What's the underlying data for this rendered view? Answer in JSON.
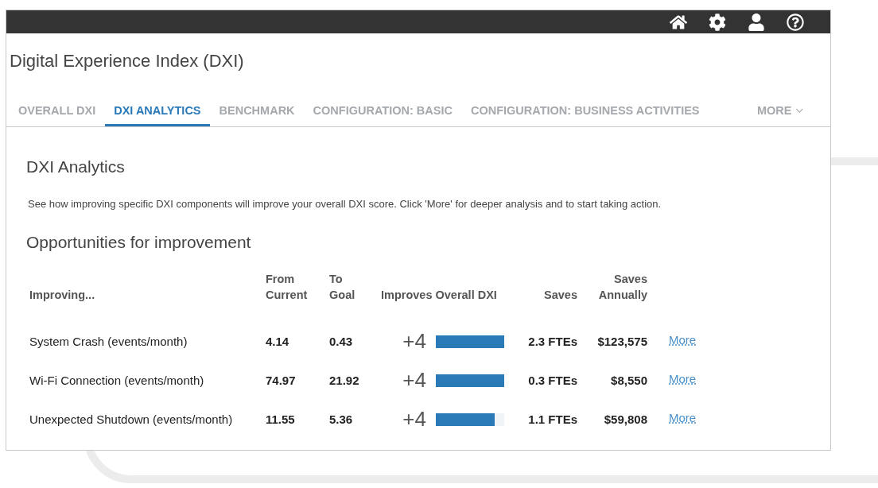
{
  "page_title": "Digital Experience Index (DXI)",
  "tabs": [
    {
      "label": "OVERALL DXI",
      "selected": false
    },
    {
      "label": "DXI ANALYTICS",
      "selected": true
    },
    {
      "label": "BENCHMARK",
      "selected": false
    },
    {
      "label": "CONFIGURATION: BASIC",
      "selected": false
    },
    {
      "label": "CONFIGURATION: BUSINESS ACTIVITIES",
      "selected": false
    }
  ],
  "more_menu": {
    "label": "MORE"
  },
  "section": {
    "title": "DXI Analytics",
    "description": "See how improving specific DXI components will improve your overall DXI score. Click 'More' for deeper analysis and to start taking action."
  },
  "opportunities": {
    "title": "Opportunities for improvement",
    "columns": [
      {
        "lines": [
          "Improving..."
        ]
      },
      {
        "lines": [
          "From",
          "Current"
        ]
      },
      {
        "lines": [
          "To",
          "Goal"
        ]
      },
      {
        "lines": [
          "Improves Overall DXI"
        ]
      },
      {
        "lines": [
          "Saves"
        ]
      },
      {
        "lines": [
          "Saves",
          "Annually"
        ]
      }
    ],
    "rows": [
      {
        "name": "System Crash (events/month)",
        "from": "4.14",
        "to": "0.43",
        "improves": "+4",
        "level": 1.0,
        "saves": "2.3 FTEs",
        "annually": "$123,575",
        "link": "More"
      },
      {
        "name": "Wi-Fi Connection (events/month)",
        "from": "74.97",
        "to": "21.92",
        "improves": "+4",
        "level": 1.0,
        "saves": "0.3 FTEs",
        "annually": "$8,550",
        "link": "More"
      },
      {
        "name": "Unexpected Shutdown (events/month)",
        "from": "11.55",
        "to": "5.36",
        "improves": "+4",
        "level": 0.86,
        "saves": "1.1 FTEs",
        "annually": "$59,808",
        "link": "More"
      }
    ]
  }
}
